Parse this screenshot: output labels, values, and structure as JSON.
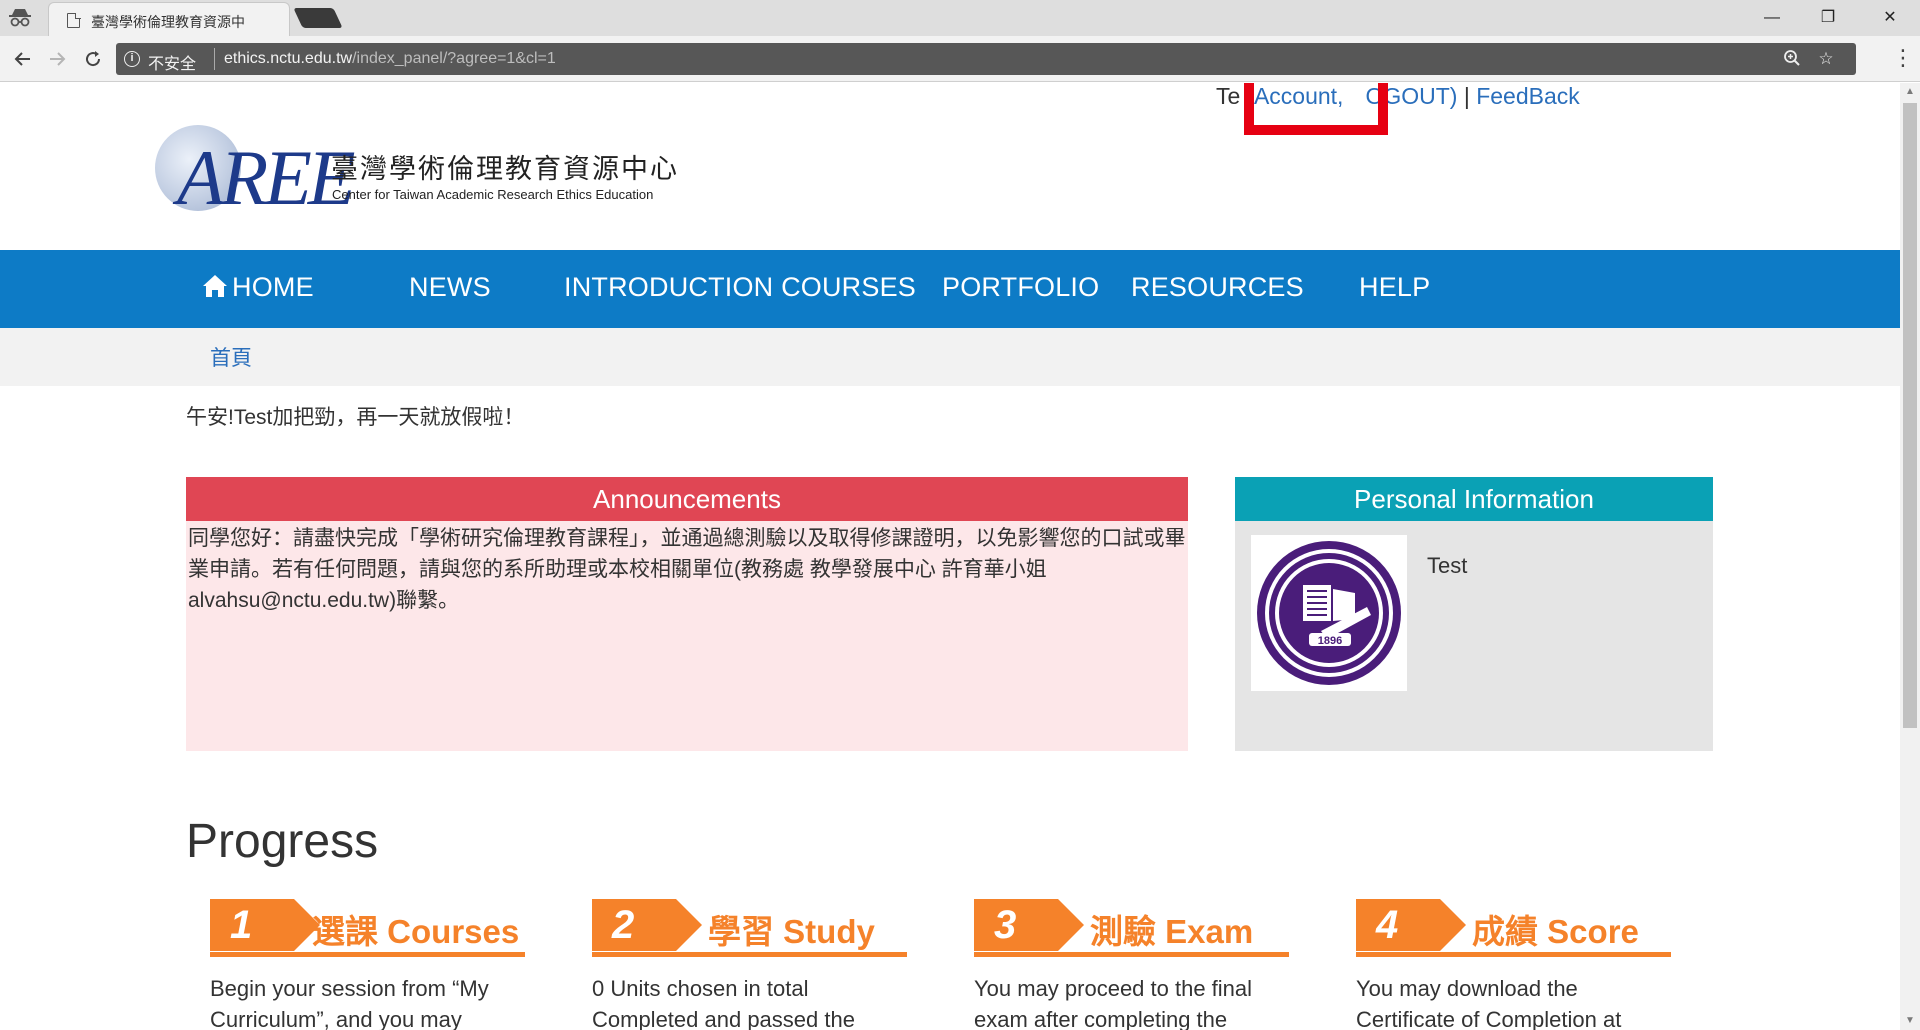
{
  "browser": {
    "tab_title": "臺灣學術倫理教育資源中",
    "tab_close": "×",
    "omnibox": {
      "security_label": "不安全",
      "url_host": "ethics.nctu.edu.tw",
      "url_path": "/index_panel/?agree=1&cl=1"
    },
    "window_controls": {
      "minimize": "—",
      "restore": "❐",
      "close": "✕"
    }
  },
  "userbar": {
    "name": "Te",
    "account": "(Account,",
    "logout": "OGOUT)",
    "separator": "|",
    "feedback": "FeedBack"
  },
  "logo": {
    "mark": "AREE",
    "cn_name": "臺灣學術倫理教育資源中心",
    "en_name": "Center for Taiwan Academic Research Ethics Education"
  },
  "nav": {
    "items": [
      {
        "label": "HOME"
      },
      {
        "label": "NEWS"
      },
      {
        "label": "INTRODUCTION COURSES"
      },
      {
        "label": "PORTFOLIO"
      },
      {
        "label": "RESOURCES"
      },
      {
        "label": "HELP"
      }
    ]
  },
  "breadcrumb": {
    "home": "首頁"
  },
  "greeting": "午安!Test加把勁，再一天就放假啦！",
  "announcements": {
    "title": "Announcements",
    "body": "同學您好：請盡快完成「學術研究倫理教育課程」，並通過總測驗以及取得修課證明，以免影響您的口試或畢業申請。若有任何問題，請與您的系所助理或本校相關單位(教務處 教學發展中心 許育華小姐 alvahsu@nctu.edu.tw)聯繫。"
  },
  "personal_info": {
    "title": "Personal Information",
    "name": "Test",
    "seal_year": "1896"
  },
  "progress": {
    "title": "Progress",
    "steps": [
      {
        "num": "1",
        "label": "選課 Courses",
        "desc": "Begin your session from “My Curriculum”, and you may"
      },
      {
        "num": "2",
        "label": "學習 Study",
        "desc": "0 Units chosen in total Completed and passed the"
      },
      {
        "num": "3",
        "label": "測驗 Exam",
        "desc": "You may proceed to the final exam after completing the"
      },
      {
        "num": "4",
        "label": "成績 Score",
        "desc": "You may download the Certificate of Completion at"
      }
    ]
  },
  "colors": {
    "nav_bg": "#0d7bc6",
    "announce_head": "#e04654",
    "announce_bg": "#fde7e9",
    "personal_head": "#0aa1b5",
    "step_orange": "#f5822a",
    "highlight_red": "#e60012"
  }
}
